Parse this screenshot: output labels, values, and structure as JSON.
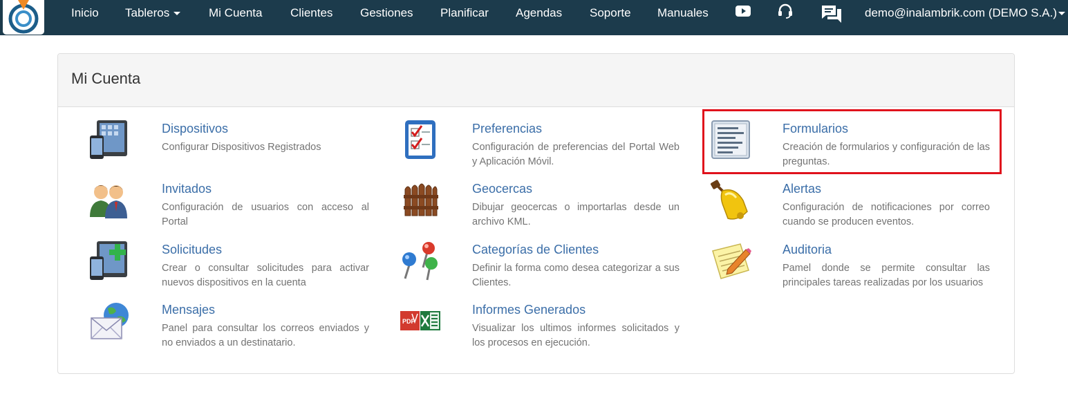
{
  "nav": {
    "items": [
      {
        "label": "Inicio"
      },
      {
        "label": "Tableros"
      },
      {
        "label": "Mi Cuenta"
      },
      {
        "label": "Clientes"
      },
      {
        "label": "Gestiones"
      },
      {
        "label": "Planificar"
      },
      {
        "label": "Agendas"
      },
      {
        "label": "Soporte"
      },
      {
        "label": "Manuales"
      }
    ],
    "icons": [
      "youtube-icon",
      "headset-icon",
      "chat-icon"
    ],
    "user": "demo@inalambrik.com (DEMO S.A.)"
  },
  "panel": {
    "title": "Mi Cuenta",
    "items": [
      {
        "title": "Dispositivos",
        "desc": "Configurar Dispositivos Registrados",
        "icon": "devices-icon"
      },
      {
        "title": "Preferencias",
        "desc": "Configuración de preferencias del Portal Web y Aplicación Móvil.",
        "icon": "checklist-icon"
      },
      {
        "title": "Formularios",
        "desc": "Creación de formularios y configuración de las preguntas.",
        "icon": "form-icon"
      },
      {
        "title": "Invitados",
        "desc": "Configuración de usuarios con acceso al Portal",
        "icon": "users-icon"
      },
      {
        "title": "Geocercas",
        "desc": "Dibujar geocercas o importarlas desde un archivo KML.",
        "icon": "fence-icon"
      },
      {
        "title": "Alertas",
        "desc": "Configuración de notificaciones por correo cuando se producen eventos.",
        "icon": "bell-icon"
      },
      {
        "title": "Solicitudes",
        "desc": "Crear o consultar solicitudes para activar nuevos dispositivos en la cuenta",
        "icon": "add-device-icon"
      },
      {
        "title": "Categorías de Clientes",
        "desc": "Definir la forma como desea categorizar a sus Clientes.",
        "icon": "pins-icon"
      },
      {
        "title": "Auditoria",
        "desc": "Pamel donde se permite consultar las principales tareas realizadas por los usuarios",
        "icon": "notepad-icon"
      },
      {
        "title": "Mensajes",
        "desc": "Panel para consultar los correos enviados y no enviados a un destinatario.",
        "icon": "mail-globe-icon"
      },
      {
        "title": "Informes Generados",
        "desc": "Visualizar los ultimos informes solicitados y los procesos en ejecución.",
        "icon": "pdf-excel-icon"
      }
    ]
  },
  "colors": {
    "navbar": "#1c3b4c",
    "link": "#3b6ea8",
    "highlight": "#e0121c"
  }
}
